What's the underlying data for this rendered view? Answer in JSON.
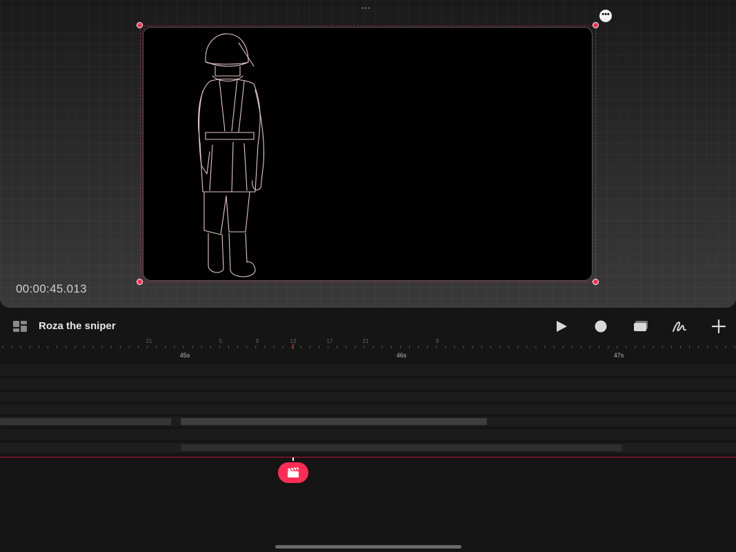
{
  "viewer": {
    "timecode": "00:00:45.013"
  },
  "toolbar": {
    "project_title": "Roza the sniper",
    "tools": [
      "play-icon",
      "record-icon",
      "layers-icon",
      "draw-icon",
      "add-icon"
    ]
  },
  "ruler": {
    "frame_labels": [
      "21",
      "5",
      "9",
      "13",
      "17",
      "21",
      "9"
    ],
    "second_labels": [
      "45s",
      "46s",
      "47s"
    ]
  },
  "colors": {
    "accent": "#ff2d55",
    "background": "#151515",
    "frame": "#000000"
  }
}
